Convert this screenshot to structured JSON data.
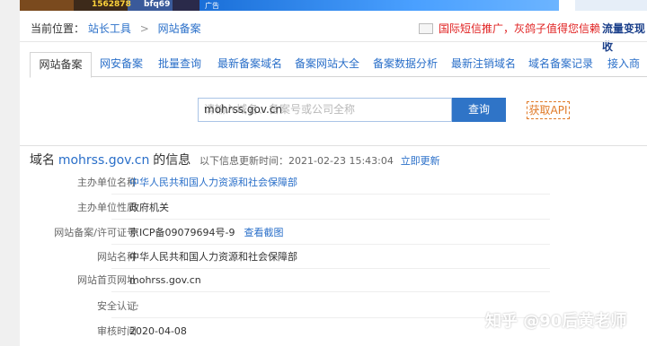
{
  "banner": {
    "ad_text_1": "1562878",
    "ad_text_2": "bfq69",
    "ad_tag": "广告"
  },
  "breadcrumb": {
    "prefix": "当前位置：",
    "item1": "站长工具",
    "separator": ">",
    "item2": "网站备案"
  },
  "promo": {
    "text": "国际短信推广，灰鸽子值得您信赖",
    "right_text": "流量变现收"
  },
  "tabs": [
    {
      "label": "网站备案",
      "active": true
    },
    {
      "label": "网安备案",
      "active": false
    },
    {
      "label": "批量查询",
      "active": false
    },
    {
      "label": "最新备案域名",
      "active": false
    },
    {
      "label": "备案网站大全",
      "active": false
    },
    {
      "label": "备案数据分析",
      "active": false
    },
    {
      "label": "最新注销域名",
      "active": false
    },
    {
      "label": "域名备案记录",
      "active": false
    },
    {
      "label": "接入商",
      "active": false
    }
  ],
  "search": {
    "value": "mohrss.gov.cn",
    "placeholder": "请输入域名、备案号或公司全称",
    "button": "查询",
    "api_button": "获取API"
  },
  "info": {
    "prefix": "域名",
    "domain": "mohrss.gov.cn",
    "suffix": "的信息",
    "updated_label": "以下信息更新时间：2021-02-23 15:43:04",
    "refresh": "立即更新"
  },
  "rows": [
    {
      "label": "主办单位名称",
      "value": "中华人民共和国人力资源和社会保障部",
      "link": true
    },
    {
      "label": "主办单位性质",
      "value": "政府机关",
      "link": false
    },
    {
      "label": "网站备案/许可证号",
      "value": "京ICP备09079694号-9",
      "link": false,
      "extra": "查看截图"
    },
    {
      "label": "网站名称",
      "value": "中华人民共和国人力资源和社会保障部",
      "link": false
    },
    {
      "label": "网站首页网址",
      "value": "mohrss.gov.cn",
      "link": false
    },
    {
      "label": "安全认证",
      "value": "",
      "link": false,
      "loading": true
    },
    {
      "label": "审核时间",
      "value": "2020-04-08",
      "link": false
    }
  ],
  "watermark": "知乎 @90后黄老师",
  "colors": {
    "link": "#2a6fc9",
    "accent_button": "#2f74c7",
    "promo_red": "#e02020",
    "api_orange": "#e07a28"
  }
}
